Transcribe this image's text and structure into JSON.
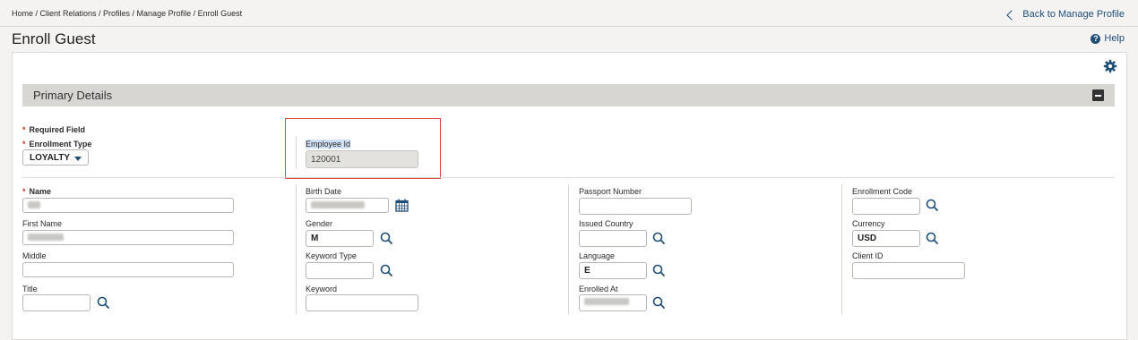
{
  "breadcrumb": "Home / Client Relations / Profiles / Manage Profile / Enroll Guest",
  "back_link": "Back to Manage Profile",
  "page_title": "Enroll Guest",
  "help_label": "Help",
  "section": {
    "title": "Primary Details"
  },
  "required_label": "Required Field",
  "enrollment_type": {
    "label": "Enrollment Type",
    "value": "LOYALTY"
  },
  "employee_id": {
    "label": "Employee Id",
    "value": "120001"
  },
  "col1": {
    "name_label": "Name",
    "first_name_label": "First Name",
    "middle_label": "Middle",
    "title_label": "Title"
  },
  "col2": {
    "birth_date_label": "Birth Date",
    "gender_label": "Gender",
    "gender_value": "M",
    "keyword_type_label": "Keyword Type",
    "keyword_label": "Keyword"
  },
  "col3": {
    "passport_label": "Passport Number",
    "issued_country_label": "Issued Country",
    "language_label": "Language",
    "language_value": "E",
    "enrolled_at_label": "Enrolled At"
  },
  "col4": {
    "enrollment_code_label": "Enrollment Code",
    "currency_label": "Currency",
    "currency_value": "USD",
    "client_id_label": "Client ID"
  },
  "icons": {
    "search": "magnifier-icon",
    "calendar": "calendar-icon",
    "gear": "gear-icon",
    "help": "help-icon",
    "collapse": "collapse-icon"
  },
  "colors": {
    "accent": "#1f4e79",
    "required": "#c0392b",
    "highlight": "#e04848",
    "section_bar": "#d8d6d2"
  }
}
